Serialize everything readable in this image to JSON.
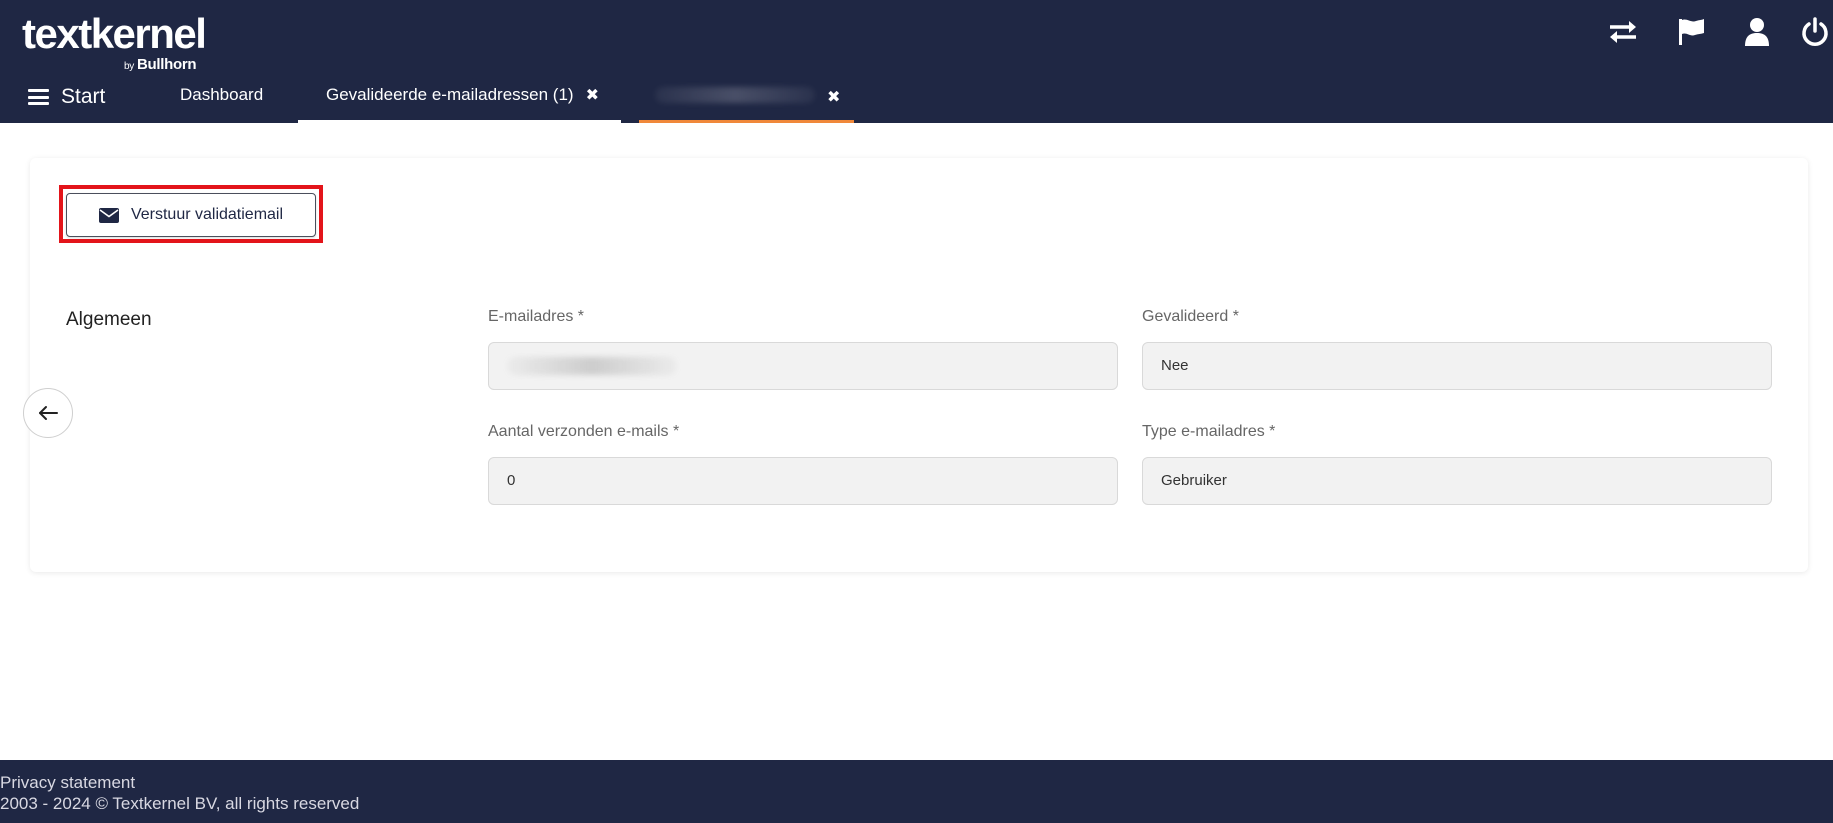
{
  "header": {
    "logo_text": "textkernel",
    "logo_by": "by",
    "logo_sub": "Bullhorn",
    "icons": [
      "switch-arrows-icon",
      "flag-icon",
      "user-icon",
      "power-icon"
    ]
  },
  "nav": {
    "menu_label": "Start",
    "tabs": [
      {
        "label": "Dashboard"
      },
      {
        "label": "Gevalideerde e-mailadressen (1)",
        "close": "✖"
      },
      {
        "label": "",
        "close": "✖"
      }
    ]
  },
  "toolbar": {
    "send_label": "Verstuur validatiemail"
  },
  "form": {
    "section_title": "Algemeen",
    "email_label": "E-mailadres *",
    "email_value": "",
    "validated_label": "Gevalideerd *",
    "validated_value": "Nee",
    "sent_count_label": "Aantal verzonden e-mails *",
    "sent_count_value": "0",
    "email_type_label": "Type e-mailadres *",
    "email_type_value": "Gebruiker"
  },
  "footer": {
    "privacy": "Privacy statement",
    "copyright": "2003 - 2024 © Textkernel BV, all rights reserved"
  },
  "colors": {
    "header_bg": "#1f2744",
    "active_tab_underline": "#f0883a",
    "highlight": "#e3141a"
  }
}
